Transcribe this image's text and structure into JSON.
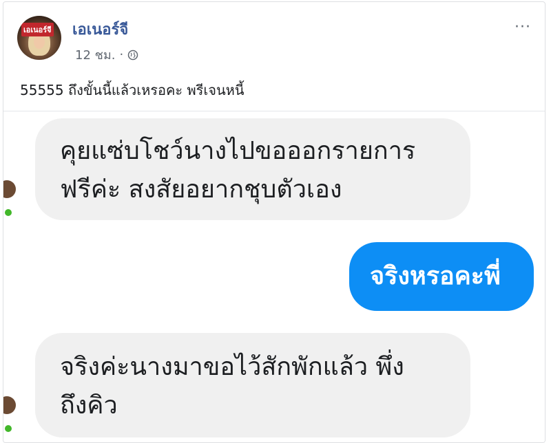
{
  "post": {
    "author": "เอเนอร์จี",
    "avatar_tag": "เอเนอร์จี",
    "time": "12 ชม.",
    "separator": "·",
    "text": "55555 ถึงขั้นนี้แล้วเหรอคะ พรีเจนหนี้",
    "more": "···"
  },
  "chat": {
    "messages": [
      {
        "side": "in",
        "lines": [
          "คุยแซ่บโชว์นางไปขอออกรายการ",
          "ฟรีค่ะ  สงสัยอยากชุบตัวเอง"
        ]
      },
      {
        "side": "out",
        "lines": [
          "จริงหรอคะพี่"
        ]
      },
      {
        "side": "in",
        "lines": [
          "จริงค่ะนางมาขอไว้สักพักแล้ว พึ่ง",
          "ถึงคิว"
        ]
      }
    ]
  },
  "colors": {
    "author_link": "#385898",
    "bubble_in": "#f0f0f0",
    "bubble_out": "#0d8ef5",
    "online": "#42b72a"
  }
}
